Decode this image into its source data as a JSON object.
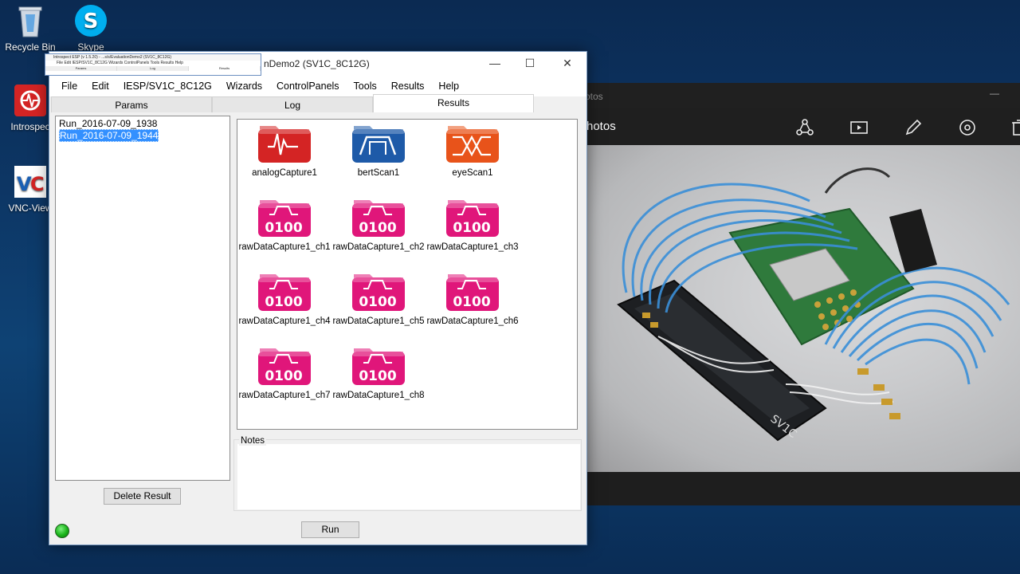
{
  "desktop": {
    "icons": [
      {
        "label": "Recycle Bin",
        "icon": "recycle-bin-icon"
      },
      {
        "label": "Skype",
        "icon": "skype-icon"
      },
      {
        "label": "Introspec",
        "icon": "introspect-icon"
      },
      {
        "label": "VNC-View",
        "icon": "vnc-viewer-icon"
      }
    ]
  },
  "photos": {
    "title": "otos",
    "app_name": "hotos",
    "toolbar": [
      "share-icon",
      "slideshow-icon",
      "edit-icon",
      "rotate-icon",
      "delete-icon"
    ]
  },
  "thumbnail": {
    "title": "Introspect ESP (v 1.5.20) - ...s/s/EvaluationDemo2 (SV1C_8C12G)",
    "menu": "File  Edit  IESP/SV1C_8C12G  Wizards  ControlPanels  Tools  Results  Help",
    "tabs": [
      "Params",
      "Log",
      "Results"
    ]
  },
  "window": {
    "title": "nDemo2 (SV1C_8C12G)",
    "menu": [
      "File",
      "Edit",
      "IESP/SV1C_8C12G",
      "Wizards",
      "ControlPanels",
      "Tools",
      "Results",
      "Help"
    ],
    "tabs": [
      "Params",
      "Log",
      "Results"
    ],
    "active_tab": "Results",
    "runs": [
      "Run_2016-07-09_1938",
      "Run_2016-07-09_1944"
    ],
    "selected_run": "Run_2016-07-09_1944",
    "delete_button": "Delete Result",
    "results": [
      {
        "name": "analogCapture1",
        "kind": "analog"
      },
      {
        "name": "bertScan1",
        "kind": "bert"
      },
      {
        "name": "eyeScan1",
        "kind": "eye"
      },
      {
        "name": "rawDataCapture1_ch1",
        "kind": "raw"
      },
      {
        "name": "rawDataCapture1_ch2",
        "kind": "raw"
      },
      {
        "name": "rawDataCapture1_ch3",
        "kind": "raw"
      },
      {
        "name": "rawDataCapture1_ch4",
        "kind": "raw"
      },
      {
        "name": "rawDataCapture1_ch5",
        "kind": "raw"
      },
      {
        "name": "rawDataCapture1_ch6",
        "kind": "raw"
      },
      {
        "name": "rawDataCapture1_ch7",
        "kind": "raw"
      },
      {
        "name": "rawDataCapture1_ch8",
        "kind": "raw"
      }
    ],
    "raw_icon_text": "0100",
    "notes_label": "Notes",
    "run_button": "Run",
    "status": "green"
  },
  "colors": {
    "analog": "#d42424",
    "bert": "#1e5aa8",
    "eye": "#e8531a",
    "raw": "#e0167a",
    "selection": "#3390ff"
  }
}
